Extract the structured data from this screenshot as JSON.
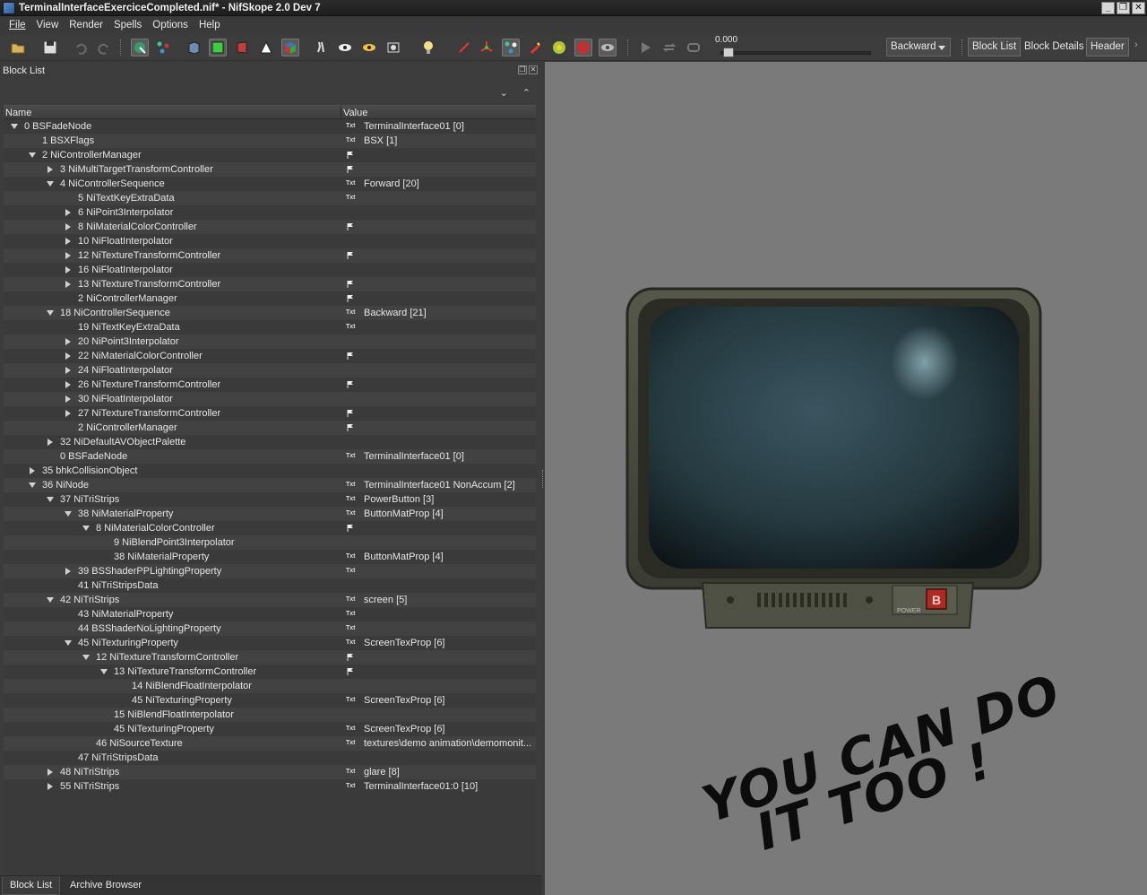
{
  "window": {
    "title": "TerminalInterfaceExerciceCompleted.nif* - NifSkope 2.0 Dev 7",
    "buttons": [
      "_",
      "❐",
      "✕"
    ]
  },
  "menu": [
    "File",
    "View",
    "Render",
    "Spells",
    "Options",
    "Help"
  ],
  "toolbar": {
    "time_value": "0.000",
    "animation": "Backward",
    "dock_toggles": [
      "Block List",
      "Block Details",
      "Header"
    ]
  },
  "block_list": {
    "title": "Block List",
    "headers": {
      "name": "Name",
      "value": "Value"
    },
    "rows": [
      {
        "d": 0,
        "a": "exp",
        "name": "0 BSFadeNode",
        "icon": "txt",
        "value": "TerminalInterface01 [0]"
      },
      {
        "d": 1,
        "a": "",
        "name": "1 BSXFlags",
        "icon": "txt",
        "value": "BSX [1]"
      },
      {
        "d": 1,
        "a": "exp",
        "name": "2 NiControllerManager",
        "icon": "flag",
        "value": ""
      },
      {
        "d": 2,
        "a": "col",
        "name": "3 NiMultiTargetTransformController",
        "icon": "flag",
        "value": ""
      },
      {
        "d": 2,
        "a": "exp",
        "name": "4 NiControllerSequence",
        "icon": "txt",
        "value": "Forward [20]"
      },
      {
        "d": 3,
        "a": "",
        "name": "5 NiTextKeyExtraData",
        "icon": "txt",
        "value": ""
      },
      {
        "d": 3,
        "a": "col",
        "name": "6 NiPoint3Interpolator",
        "icon": "",
        "value": ""
      },
      {
        "d": 3,
        "a": "col",
        "name": "8 NiMaterialColorController",
        "icon": "flag",
        "value": ""
      },
      {
        "d": 3,
        "a": "col",
        "name": "10 NiFloatInterpolator",
        "icon": "",
        "value": ""
      },
      {
        "d": 3,
        "a": "col",
        "name": "12 NiTextureTransformController",
        "icon": "flag",
        "value": ""
      },
      {
        "d": 3,
        "a": "col",
        "name": "16 NiFloatInterpolator",
        "icon": "",
        "value": ""
      },
      {
        "d": 3,
        "a": "col",
        "name": "13 NiTextureTransformController",
        "icon": "flag",
        "value": ""
      },
      {
        "d": 3,
        "a": "",
        "name": "2 NiControllerManager",
        "icon": "flag",
        "value": ""
      },
      {
        "d": 2,
        "a": "exp",
        "name": "18 NiControllerSequence",
        "icon": "txt",
        "value": "Backward [21]"
      },
      {
        "d": 3,
        "a": "",
        "name": "19 NiTextKeyExtraData",
        "icon": "txt",
        "value": ""
      },
      {
        "d": 3,
        "a": "col",
        "name": "20 NiPoint3Interpolator",
        "icon": "",
        "value": ""
      },
      {
        "d": 3,
        "a": "col",
        "name": "22 NiMaterialColorController",
        "icon": "flag",
        "value": ""
      },
      {
        "d": 3,
        "a": "col",
        "name": "24 NiFloatInterpolator",
        "icon": "",
        "value": ""
      },
      {
        "d": 3,
        "a": "col",
        "name": "26 NiTextureTransformController",
        "icon": "flag",
        "value": ""
      },
      {
        "d": 3,
        "a": "col",
        "name": "30 NiFloatInterpolator",
        "icon": "",
        "value": ""
      },
      {
        "d": 3,
        "a": "col",
        "name": "27 NiTextureTransformController",
        "icon": "flag",
        "value": ""
      },
      {
        "d": 3,
        "a": "",
        "name": "2 NiControllerManager",
        "icon": "flag",
        "value": ""
      },
      {
        "d": 2,
        "a": "col",
        "name": "32 NiDefaultAVObjectPalette",
        "icon": "",
        "value": ""
      },
      {
        "d": 2,
        "a": "",
        "name": "0 BSFadeNode",
        "icon": "txt",
        "value": "TerminalInterface01 [0]"
      },
      {
        "d": 1,
        "a": "col",
        "name": "35 bhkCollisionObject",
        "icon": "",
        "value": ""
      },
      {
        "d": 1,
        "a": "exp",
        "name": "36 NiNode",
        "icon": "txt",
        "value": "TerminalInterface01 NonAccum [2]"
      },
      {
        "d": 2,
        "a": "exp",
        "name": "37 NiTriStrips",
        "icon": "txt",
        "value": "PowerButton [3]"
      },
      {
        "d": 3,
        "a": "exp",
        "name": "38 NiMaterialProperty",
        "icon": "txt",
        "value": "ButtonMatProp [4]"
      },
      {
        "d": 4,
        "a": "exp",
        "name": "8 NiMaterialColorController",
        "icon": "flag",
        "value": ""
      },
      {
        "d": 5,
        "a": "",
        "name": "9 NiBlendPoint3Interpolator",
        "icon": "",
        "value": ""
      },
      {
        "d": 5,
        "a": "",
        "name": "38 NiMaterialProperty",
        "icon": "txt",
        "value": "ButtonMatProp [4]"
      },
      {
        "d": 3,
        "a": "col",
        "name": "39 BSShaderPPLightingProperty",
        "icon": "txt",
        "value": ""
      },
      {
        "d": 3,
        "a": "",
        "name": "41 NiTriStripsData",
        "icon": "",
        "value": ""
      },
      {
        "d": 2,
        "a": "exp",
        "name": "42 NiTriStrips",
        "icon": "txt",
        "value": "screen [5]"
      },
      {
        "d": 3,
        "a": "",
        "name": "43 NiMaterialProperty",
        "icon": "txt",
        "value": ""
      },
      {
        "d": 3,
        "a": "",
        "name": "44 BSShaderNoLightingProperty",
        "icon": "txt",
        "value": ""
      },
      {
        "d": 3,
        "a": "exp",
        "name": "45 NiTexturingProperty",
        "icon": "txt",
        "value": "ScreenTexProp [6]"
      },
      {
        "d": 4,
        "a": "exp",
        "name": "12 NiTextureTransformController",
        "icon": "flag",
        "value": ""
      },
      {
        "d": 5,
        "a": "exp",
        "name": "13 NiTextureTransformController",
        "icon": "flag",
        "value": ""
      },
      {
        "d": 6,
        "a": "",
        "name": "14 NiBlendFloatInterpolator",
        "icon": "",
        "value": ""
      },
      {
        "d": 6,
        "a": "",
        "name": "45 NiTexturingProperty",
        "icon": "txt",
        "value": "ScreenTexProp [6]"
      },
      {
        "d": 5,
        "a": "",
        "name": "15 NiBlendFloatInterpolator",
        "icon": "",
        "value": ""
      },
      {
        "d": 5,
        "a": "",
        "name": "45 NiTexturingProperty",
        "icon": "txt",
        "value": "ScreenTexProp [6]"
      },
      {
        "d": 4,
        "a": "",
        "name": "46 NiSourceTexture",
        "icon": "txt",
        "value": "textures\\demo animation\\demomonit..."
      },
      {
        "d": 3,
        "a": "",
        "name": "47 NiTriStripsData",
        "icon": "",
        "value": ""
      },
      {
        "d": 2,
        "a": "col",
        "name": "48 NiTriStrips",
        "icon": "txt",
        "value": "glare [8]"
      },
      {
        "d": 2,
        "a": "col",
        "name": "55 NiTriStrips",
        "icon": "txt",
        "value": "TerminalInterface01:0 [10]"
      }
    ]
  },
  "dock_tabs": [
    "Block List",
    "Archive Browser"
  ],
  "viewport": {
    "monitor_power_label": "POWER",
    "monitor_button_letter": "B",
    "graffiti_line1": "YOU CAN DO",
    "graffiti_line2": "IT TOO !"
  },
  "colors": {
    "background": "#3c3c3c",
    "viewport": "#7a7a7a",
    "screen": "#2a3f45"
  }
}
